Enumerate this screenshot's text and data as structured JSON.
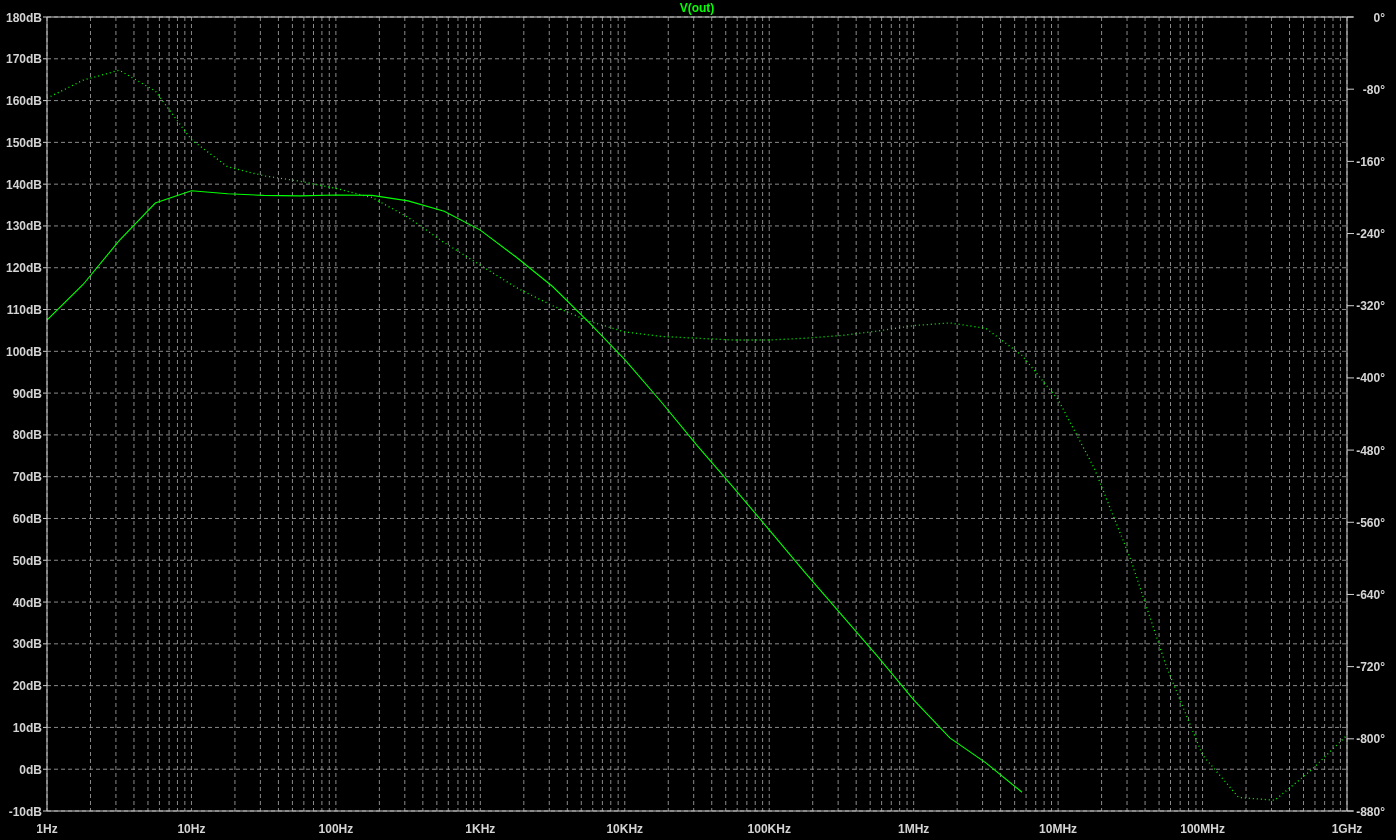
{
  "plot": {
    "chart_data": {
      "type": "line",
      "title": "V(out)",
      "grid": true,
      "categories": [
        "1Hz",
        null,
        null,
        null,
        "10Hz",
        null,
        null,
        null,
        "100Hz",
        null,
        null,
        null,
        "1KHz",
        null,
        null,
        null,
        "10KHz",
        null,
        null,
        null,
        "100KHz",
        null,
        null,
        null,
        "1MHz",
        null,
        null,
        null,
        "10MHz",
        null,
        null,
        null,
        "100MHz",
        null,
        null,
        null,
        "1GHz"
      ],
      "ylim": [
        -10,
        180
      ],
      "yticks": [
        {
          "value": 180,
          "label": "180dB"
        },
        {
          "value": 170,
          "label": "170dB"
        },
        {
          "value": 160,
          "label": "160dB"
        },
        {
          "value": 150,
          "label": "150dB"
        },
        {
          "value": 140,
          "label": "140dB"
        },
        {
          "value": 130,
          "label": "130dB"
        },
        {
          "value": 120,
          "label": "120dB"
        },
        {
          "value": 110,
          "label": "110dB"
        },
        {
          "value": 100,
          "label": "100dB"
        },
        {
          "value": 90,
          "label": "90dB"
        },
        {
          "value": 80,
          "label": "80dB"
        },
        {
          "value": 70,
          "label": "70dB"
        },
        {
          "value": 60,
          "label": "60dB"
        },
        {
          "value": 50,
          "label": "50dB"
        },
        {
          "value": 40,
          "label": "40dB"
        },
        {
          "value": 30,
          "label": "30dB"
        },
        {
          "value": 20,
          "label": "20dB"
        },
        {
          "value": 10,
          "label": "10dB"
        },
        {
          "value": 0,
          "label": "0dB"
        },
        {
          "value": -10,
          "label": "-10dB"
        }
      ],
      "y2lim": [
        -880,
        0
      ],
      "y2ticks": [
        {
          "value": 0,
          "label": "0°"
        },
        {
          "value": -80,
          "label": "-80°"
        },
        {
          "value": -160,
          "label": "-160°"
        },
        {
          "value": -240,
          "label": "-240°"
        },
        {
          "value": -320,
          "label": "-320°"
        },
        {
          "value": -400,
          "label": "-400°"
        },
        {
          "value": -480,
          "label": "-480°"
        },
        {
          "value": -560,
          "label": "-560°"
        },
        {
          "value": -640,
          "label": "-640°"
        },
        {
          "value": -720,
          "label": "-720°"
        },
        {
          "value": -800,
          "label": "-800°"
        },
        {
          "value": -880,
          "label": "-880°"
        }
      ],
      "series": [
        {
          "color": "#00ff00",
          "line_style": "solid",
          "values": [
            107.5,
            116,
            126.5,
            135.5,
            138.4,
            137.7,
            137.3,
            137.2,
            137.4,
            137.3,
            136,
            133.5,
            129,
            122.5,
            115.5,
            107,
            98,
            88,
            77.5,
            67.5,
            57.3,
            47,
            37,
            27,
            16.6,
            7.5,
            1.5,
            -5.5,
            null,
            null,
            null,
            null,
            null,
            null,
            null,
            null,
            null
          ]
        },
        {
          "color": "#00ff00",
          "axis": "y2",
          "line_style": "dotted",
          "values": [
            -90,
            -70,
            -59,
            -82,
            -136,
            -166,
            -176,
            -182,
            -190,
            -200,
            -222,
            -250,
            -275,
            -300,
            -320,
            -337,
            -349,
            -354,
            -356,
            -358,
            -358,
            -356,
            -353,
            -348,
            -342,
            -339,
            -345,
            -375,
            -424,
            -500,
            -600,
            -720,
            -818,
            -865,
            -868,
            -835,
            -796
          ]
        }
      ]
    }
  }
}
